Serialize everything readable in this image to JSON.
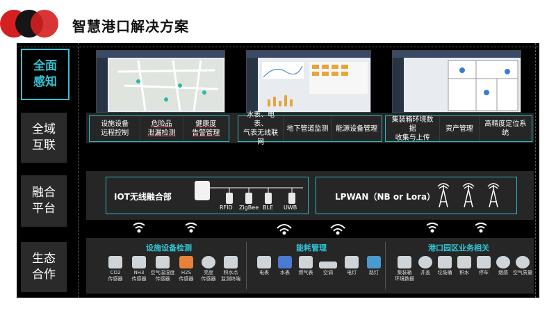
{
  "colors": {
    "accent": "#31c4d4",
    "logo_red": "#d42020",
    "logo_dark": "#151515"
  },
  "page_title": "智慧港口解决方案",
  "rows": {
    "perception": {
      "label": "全面\n感知"
    },
    "network": {
      "label": "全域\n互联",
      "group1": [
        "设施设备\n远程控制",
        "危险品\n泄漏检测",
        "健康度\n告警管理"
      ],
      "group2": [
        "水表、电表、\n气表无线联网",
        "地下管道监测",
        "能源设备管理"
      ],
      "group3": [
        "集装箱环境数据\n收集与上传",
        "资产管理",
        "高精度定位系统"
      ]
    },
    "platform": {
      "label": "融合\n平台",
      "iot_title": "IOT无线融合部",
      "iot_items": [
        "RFID",
        "ZigBee",
        "BLE",
        "UWB"
      ],
      "lpwan_title": "LPWAN（NB or Lora）"
    },
    "ecosystem": {
      "label": "生态\n合作",
      "facility": {
        "title": "设施设备检测",
        "devices": [
          "CO2\n传感器",
          "NH3\n传感器",
          "空气温湿度\n传感器",
          "H2S\n传感器",
          "亮度\n传感器",
          "积水点\n监测终端"
        ]
      },
      "energy": {
        "title": "能耗管理",
        "devices": [
          "电表",
          "水表",
          "燃气表",
          "空调",
          "电灯",
          "路灯"
        ]
      },
      "port": {
        "title": "港口园区业务相关",
        "devices": [
          "集装箱\n环境数据",
          "井盖",
          "垃圾桶",
          "积水",
          "停车",
          "烟感",
          "空气质量"
        ]
      }
    }
  }
}
